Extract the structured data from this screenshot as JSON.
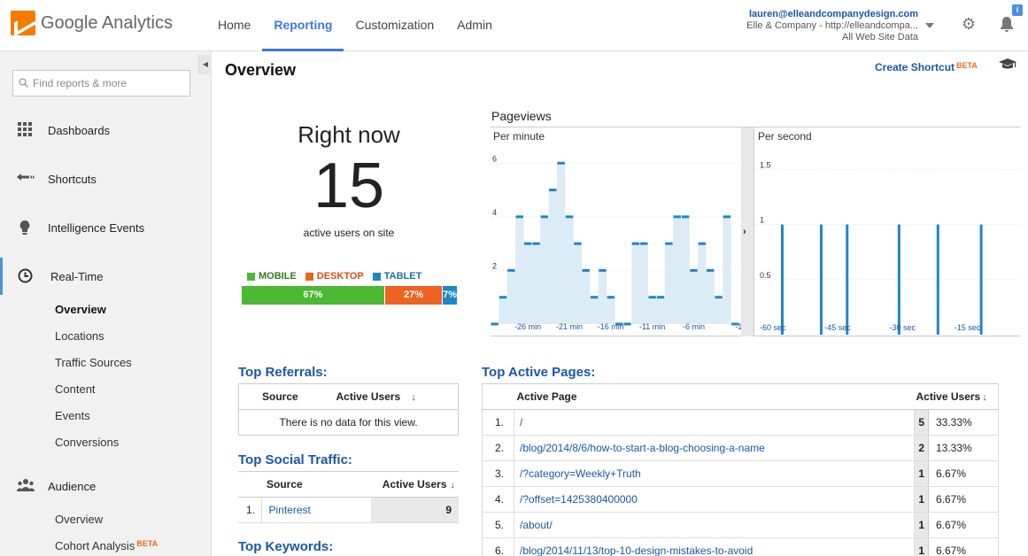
{
  "header": {
    "app_name": "Google Analytics",
    "nav": [
      "Home",
      "Reporting",
      "Customization",
      "Admin"
    ],
    "active_nav": "Reporting",
    "account_email": "lauren@elleandcompanydesign.com",
    "account_property": "Elle & Company - http://elleandcompa...",
    "account_view": "All Web Site Data",
    "notification_count": "i"
  },
  "sidebar": {
    "search_placeholder": "Find reports & more",
    "items": [
      {
        "label": "Dashboards",
        "icon": "grid-icon"
      },
      {
        "label": "Shortcuts",
        "icon": "shortcut-arrow-icon"
      },
      {
        "label": "Intelligence Events",
        "icon": "lightbulb-icon"
      },
      {
        "label": "Real-Time",
        "icon": "clock-icon"
      },
      {
        "label": "Audience",
        "icon": "people-icon"
      }
    ],
    "realtime_sub": [
      "Overview",
      "Locations",
      "Traffic Sources",
      "Content",
      "Events",
      "Conversions"
    ],
    "audience_sub": [
      "Overview",
      "Cohort Analysis"
    ],
    "beta_label": "BETA"
  },
  "main": {
    "title": "Overview",
    "create_shortcut": "Create Shortcut",
    "beta_label": "BETA",
    "right_now_title": "Right now",
    "active_users": "15",
    "active_users_label": "active users on site",
    "devices": [
      {
        "name": "MOBILE",
        "percent": 67,
        "label": "67%",
        "color": "#4cb833"
      },
      {
        "name": "DESKTOP",
        "percent": 27,
        "label": "27%",
        "color": "#ed6322"
      },
      {
        "name": "TABLET",
        "percent": 7,
        "label": "7%",
        "color": "#1e87c8"
      }
    ],
    "pageviews_title": "Pageviews",
    "per_minute_label": "Per minute",
    "per_second_label": "Per second"
  },
  "chart_data": [
    {
      "type": "bar",
      "title": "Per minute",
      "ylim": [
        0,
        7
      ],
      "y_ticks": [
        "2",
        "4",
        "6"
      ],
      "x_ticks": [
        "-26 min",
        "-21 min",
        "-16 min",
        "-11 min",
        "-6 min",
        "-1"
      ],
      "x": [
        -30,
        -29,
        -28,
        -27,
        -26,
        -25,
        -24,
        -23,
        -22,
        -21,
        -20,
        -19,
        -18,
        -17,
        -16,
        -15,
        -14,
        -13,
        -12,
        -11,
        -10,
        -9,
        -8,
        -7,
        -6,
        -5,
        -4,
        -3,
        -2,
        -1
      ],
      "values": [
        0,
        1,
        2,
        4,
        3,
        3,
        4,
        5,
        6,
        4,
        3,
        2,
        1,
        2,
        1,
        0,
        0,
        3,
        3,
        1,
        1,
        3,
        4,
        4,
        2,
        3,
        2,
        1,
        4,
        0
      ]
    },
    {
      "type": "bar",
      "title": "Per second",
      "ylim": [
        0,
        1.8
      ],
      "y_ticks": [
        "0.5",
        "1",
        "1.5"
      ],
      "x_ticks": [
        "-60 sec",
        "-45 sec",
        "-30 sec",
        "-15 sec"
      ],
      "x": [
        -60,
        -51,
        -45,
        -33,
        -24,
        -14
      ],
      "values": [
        1,
        1,
        1,
        1,
        1,
        1
      ]
    }
  ],
  "top_referrals": {
    "title": "Top Referrals:",
    "col_source": "Source",
    "col_users": "Active Users",
    "empty": "There is no data for this view."
  },
  "top_social": {
    "title": "Top Social Traffic:",
    "col_source": "Source",
    "col_users": "Active Users",
    "rows": [
      {
        "n": "1.",
        "source": "Pinterest",
        "users": "9"
      }
    ]
  },
  "top_keywords": {
    "title": "Top Keywords:"
  },
  "top_pages": {
    "title": "Top Active Pages:",
    "col_page": "Active Page",
    "col_users": "Active Users",
    "rows": [
      {
        "n": "1.",
        "page": "/",
        "users": "5",
        "pct": "33.33%"
      },
      {
        "n": "2.",
        "page": "/blog/2014/8/6/how-to-start-a-blog-choosing-a-name",
        "users": "2",
        "pct": "13.33%"
      },
      {
        "n": "3.",
        "page": "/?category=Weekly+Truth",
        "users": "1",
        "pct": "6.67%"
      },
      {
        "n": "4.",
        "page": "/?offset=1425380400000",
        "users": "1",
        "pct": "6.67%"
      },
      {
        "n": "5.",
        "page": "/about/",
        "users": "1",
        "pct": "6.67%"
      },
      {
        "n": "6.",
        "page": "/blog/2014/11/13/top-10-design-mistakes-to-avoid",
        "users": "1",
        "pct": "6.67%"
      }
    ]
  }
}
